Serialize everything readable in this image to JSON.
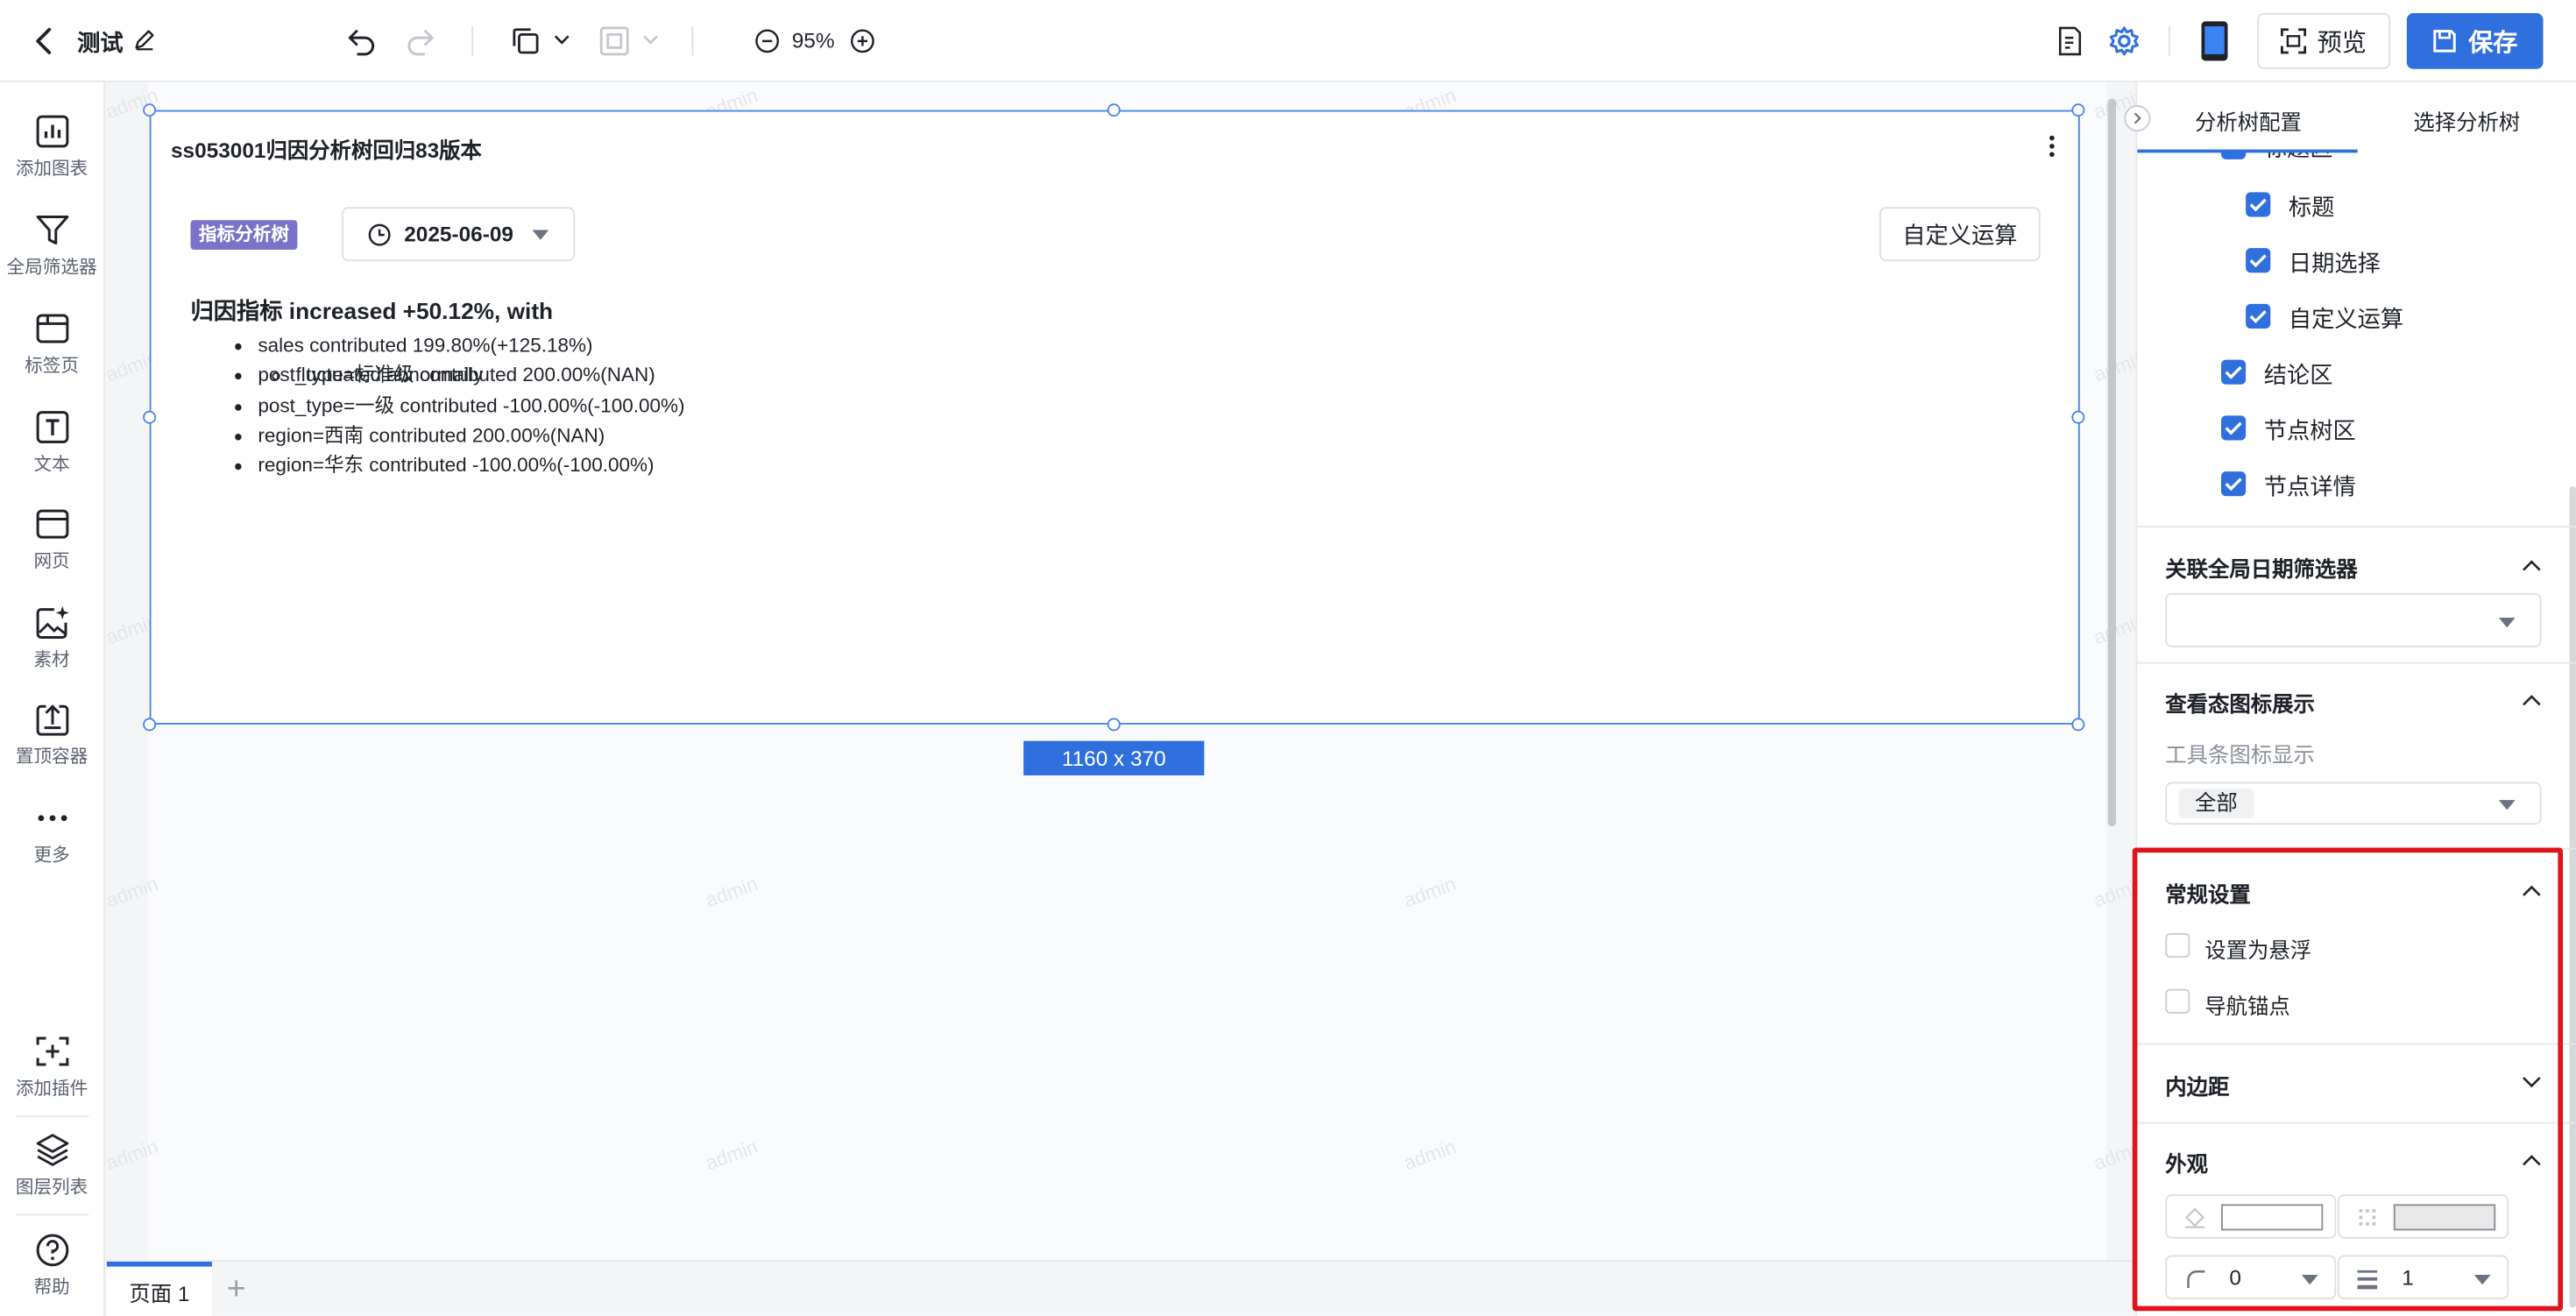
{
  "header": {
    "title": "测试",
    "zoom": "95%",
    "preview_label": "预览",
    "save_label": "保存"
  },
  "sidebar": {
    "items": [
      {
        "label": "添加图表"
      },
      {
        "label": "全局筛选器"
      },
      {
        "label": "标签页"
      },
      {
        "label": "文本"
      },
      {
        "label": "网页"
      },
      {
        "label": "素材"
      },
      {
        "label": "置顶容器"
      },
      {
        "label": "更多"
      }
    ],
    "bottom_items": [
      {
        "label": "添加插件"
      },
      {
        "label": "图层列表"
      },
      {
        "label": "帮助"
      }
    ]
  },
  "canvas": {
    "watermark": "admin",
    "widget": {
      "title": "ss053001归因分析树回归83版本",
      "badge": "指标分析树",
      "date": "2025-06-09",
      "custom_calc_button": "自定义运算",
      "summary": "归因指标 increased +50.12%, with",
      "items": [
        "sales contributed 199.80%(+125.18%)",
        "post_type=标准级 contributed 200.00%(NAN)",
        "post_type=一级 contributed -100.00%(-100.00%)",
        "region=西南 contributed 200.00%(NAN)",
        "region=华东 contributed -100.00%(-100.00%)"
      ],
      "sub_item": "fluctuated abnormally"
    },
    "size_label": "1160 x 370"
  },
  "pages": {
    "tabs": [
      {
        "label": "页面 1"
      }
    ],
    "add_label": "+"
  },
  "panel": {
    "tabs": [
      {
        "label": "分析树配置"
      },
      {
        "label": "选择分析树"
      }
    ],
    "cut_label": "标题区",
    "checkbox_items": [
      {
        "label": "标题",
        "checked": true
      },
      {
        "label": "日期选择",
        "checked": true
      },
      {
        "label": "自定义运算",
        "checked": true
      },
      {
        "label": "结论区",
        "checked": true
      },
      {
        "label": "节点树区",
        "checked": true
      },
      {
        "label": "节点详情",
        "checked": true
      }
    ],
    "global_date_filter": {
      "title": "关联全局日期筛选器",
      "value": ""
    },
    "view_icons": {
      "title": "查看态图标展示",
      "sublabel": "工具条图标显示",
      "value": "全部"
    },
    "general": {
      "title": "常规设置",
      "options": [
        {
          "label": "设置为悬浮",
          "checked": false
        },
        {
          "label": "导航锚点",
          "checked": false
        }
      ]
    },
    "padding": {
      "title": "内边距"
    },
    "appearance": {
      "title": "外观",
      "bg_color": "#ffffff",
      "border_color": "#e8e8e8",
      "radius": "0",
      "border_width": "1"
    }
  },
  "colors": {
    "accent": "#2f6fde",
    "selection": "#4a86e8",
    "badge": "#7b72c9",
    "highlight": "#e0131a"
  }
}
